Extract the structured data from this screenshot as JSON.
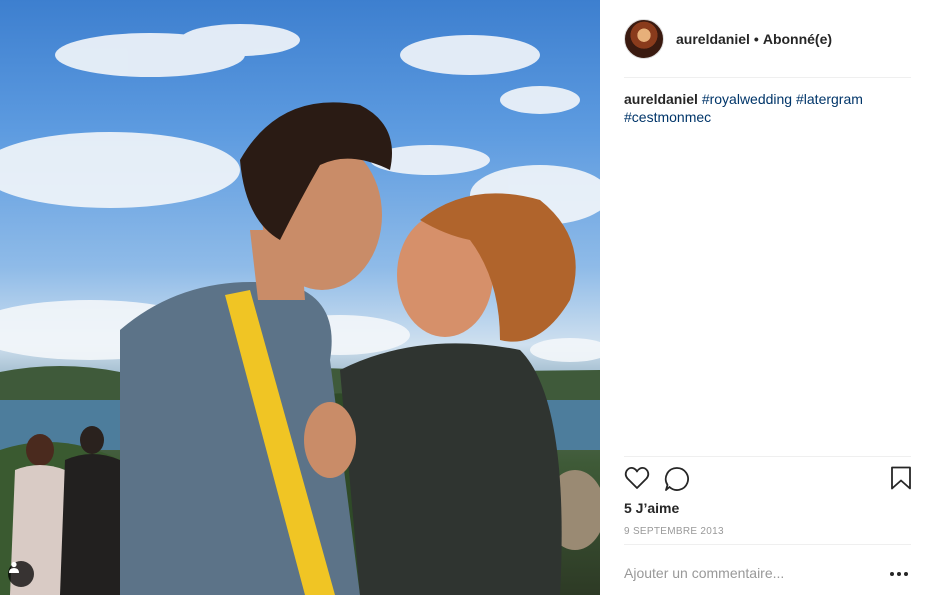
{
  "post": {
    "username": "aureldaniel",
    "separator": "•",
    "follow_status": "Abonné(e)",
    "caption_user": "aureldaniel",
    "hashtags": [
      "#royalwedding",
      "#latergram",
      "#cestmonmec"
    ],
    "likes": "5 J’aime",
    "date": "9 SEPTEMBRE 2013",
    "comment_placeholder": "Ajouter un commentaire..."
  },
  "icons": {
    "like": "heart-icon",
    "comment": "comment-icon",
    "save": "bookmark-icon",
    "more": "more-options-icon",
    "user_tag": "person-icon"
  },
  "colors": {
    "hashtag": "#003569",
    "muted": "#999999",
    "text": "#262626"
  }
}
